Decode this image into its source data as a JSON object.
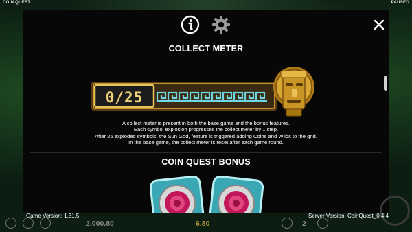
{
  "window": {
    "game_name": "COIN QUEST",
    "status": "PAUSED"
  },
  "toolbar": {
    "info_icon": "info-icon",
    "settings_icon": "gear-icon",
    "close_icon": "close-icon"
  },
  "sections": {
    "collect_meter": {
      "title": "COLLECT METER",
      "counter": "0/25",
      "description": [
        "A collect meter is present in both the base game and the bonus features.",
        "Each symbol explosion progresses the collect meter by 1 step.",
        "After 25 exploded symbols, the Sun God, feature is triggered adding Coins and Wilds to the grid.",
        "In the base game, the collect meter is reset after each game round."
      ]
    },
    "coin_quest_bonus": {
      "title": "COIN QUEST BONUS"
    }
  },
  "footer": {
    "game_version": "Game Version: 1.31.5",
    "server_version": "Server Version: CoinQuest_0.4.4"
  },
  "bottom_bar": {
    "balance": "2,000.80",
    "bet": "6.80",
    "lines": "2"
  },
  "colors": {
    "panel": "#070707",
    "accent_gold": "#c8932a",
    "meter_cyan": "#6fd6e3",
    "bet_gold": "#b59a3a"
  }
}
